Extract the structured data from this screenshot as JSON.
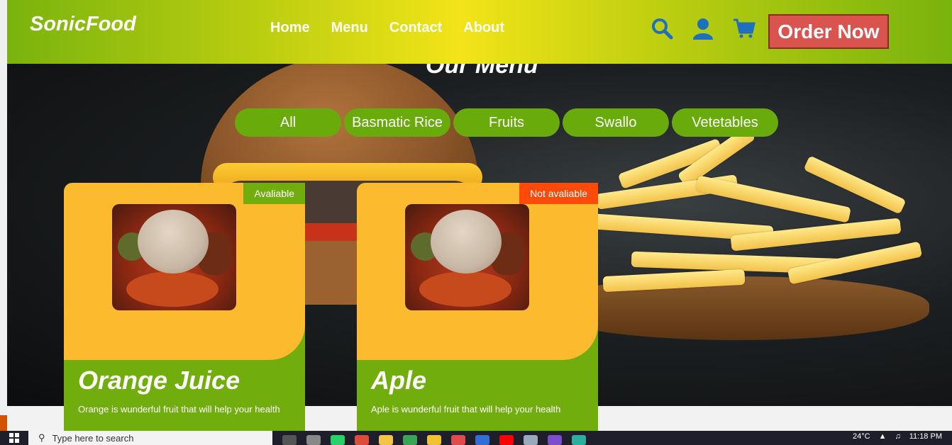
{
  "brand": "SonicFood",
  "nav": {
    "links": [
      "Home",
      "Menu",
      "Contact",
      "About"
    ],
    "icons": [
      "search-icon",
      "user-icon",
      "cart-icon"
    ],
    "order_button": "Order Now"
  },
  "section_title": "Our Menu",
  "filters": [
    "All",
    "Basmatic Rice",
    "Fruits",
    "Swallo",
    "Vetetables"
  ],
  "cards": [
    {
      "badge": "Avaliable",
      "badge_color": "#72ad0e",
      "title": "Orange Juice",
      "description": "Orange is wunderful fruit that will help your health"
    },
    {
      "badge": "Not avaliable",
      "badge_color": "#ff4a0a",
      "title": "Aple",
      "description": "Aple is wunderful fruit that will help your health"
    }
  ],
  "taskbar": {
    "search_placeholder": "Type here to search",
    "temperature": "24°C",
    "time": "11:18 PM"
  },
  "colors": {
    "header_green": "#7ab30e",
    "header_yellow": "#f2e418",
    "accent_green": "#72ad0e",
    "card_yellow": "#fcba2e",
    "order_red": "#d9534f",
    "icon_blue": "#1f6fbf"
  }
}
